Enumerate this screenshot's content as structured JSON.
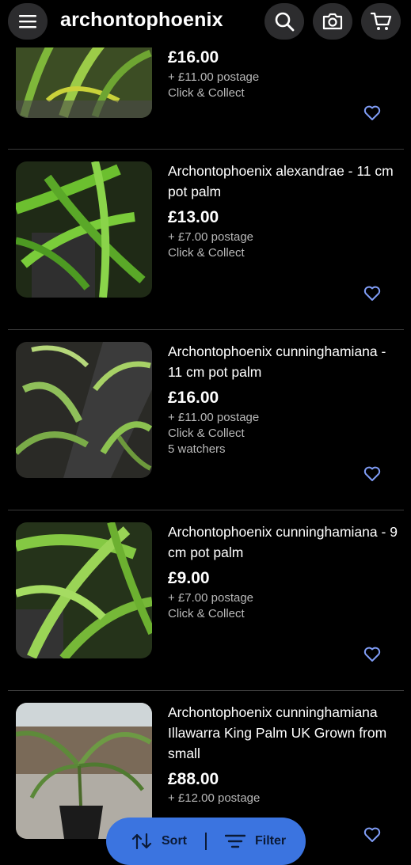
{
  "header": {
    "menu_icon": "hamburger-icon",
    "search_query": "archontophoenix",
    "search_icon": "search-icon",
    "camera_icon": "camera-icon",
    "cart_icon": "cart-icon"
  },
  "listings": [
    {
      "title": "",
      "price": "£16.00",
      "postage": "+ £11.00 postage",
      "collect": "Click & Collect",
      "watchers": ""
    },
    {
      "title": "Archontophoenix alexandrae - 11 cm pot palm",
      "price": "£13.00",
      "postage": "+ £7.00 postage",
      "collect": "Click & Collect",
      "watchers": ""
    },
    {
      "title": "Archontophoenix cunninghamiana - 11 cm pot palm",
      "price": "£16.00",
      "postage": "+ £11.00 postage",
      "collect": "Click & Collect",
      "watchers": "5 watchers"
    },
    {
      "title": "Archontophoenix cunninghamiana - 9 cm pot palm",
      "price": "£9.00",
      "postage": "+ £7.00 postage",
      "collect": "Click & Collect",
      "watchers": ""
    },
    {
      "title": "Archontophoenix cunninghamiana Illawarra King Palm UK Grown from small",
      "price": "£88.00",
      "postage": "+ £12.00 postage",
      "collect": "",
      "watchers": ""
    }
  ],
  "bottom_bar": {
    "sort_label": "Sort",
    "filter_label": "Filter"
  },
  "colors": {
    "accent": "#3b74e0",
    "heart": "#7f9cf5"
  }
}
